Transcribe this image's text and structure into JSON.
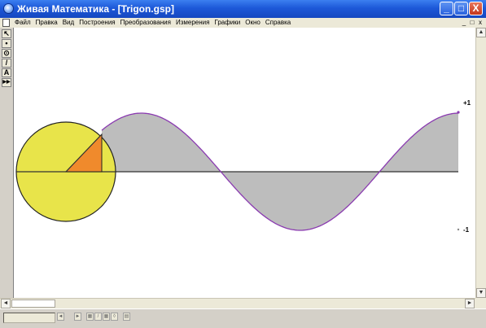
{
  "window": {
    "title": "Живая Математика - [Trigon.gsp]",
    "buttons": {
      "minimize": "_",
      "maximize": "□",
      "close": "X"
    }
  },
  "menu": {
    "items": [
      "Файл",
      "Правка",
      "Вид",
      "Построения",
      "Преобразования",
      "Измерения",
      "Графики",
      "Окно",
      "Справка"
    ],
    "mdi_buttons": {
      "minimize": "_",
      "restore": "□",
      "close": "x"
    }
  },
  "toolbox": {
    "tools": [
      {
        "name": "arrow-tool",
        "glyph": "↖"
      },
      {
        "name": "point-tool",
        "glyph": "•"
      },
      {
        "name": "compass-tool",
        "glyph": "⊙"
      },
      {
        "name": "straightedge-tool",
        "glyph": "/"
      },
      {
        "name": "text-tool",
        "glyph": "A"
      },
      {
        "name": "custom-tool",
        "glyph": "▶▶"
      }
    ]
  },
  "canvas": {
    "label_top": "+1",
    "label_bottom": "-1",
    "colors": {
      "circle_fill": "#e8e44a",
      "triangle_fill": "#f08a2c",
      "wave_fill": "#bdbdbd",
      "wave_stroke": "#8a3ab0"
    }
  },
  "statusbar": {
    "buttons": [
      "◄",
      "►",
      "▦",
      "/",
      "▦",
      "◊",
      "▤"
    ]
  }
}
